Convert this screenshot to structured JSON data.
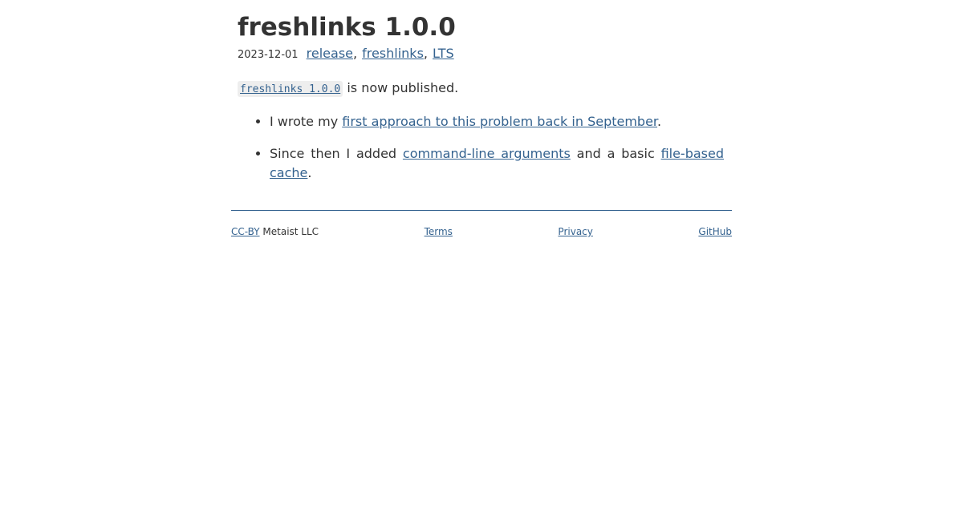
{
  "post": {
    "title": "freshlinks 1.0.0",
    "date": "2023-12-01",
    "tags": [
      "release",
      "freshlinks",
      "LTS"
    ],
    "tag_separator": ",",
    "package_code": "freshlinks 1.0.0",
    "intro_suffix": " is now published.",
    "bullets": {
      "first": {
        "prefix": "I wrote my ",
        "link": "first approach to this problem back in September",
        "suffix": "."
      },
      "second": {
        "prefix": "Since then I added ",
        "link1": "command-line arguments",
        "middle": " and a basic ",
        "link2": "file-based cache",
        "suffix": "."
      }
    }
  },
  "footer": {
    "license_link": "CC-BY",
    "license_owner": " Metaist LLC",
    "terms": "Terms",
    "privacy": "Privacy",
    "github": "GitHub"
  },
  "colors": {
    "link": "#34628f",
    "text": "#333333",
    "code_bg": "#eeeeee"
  }
}
